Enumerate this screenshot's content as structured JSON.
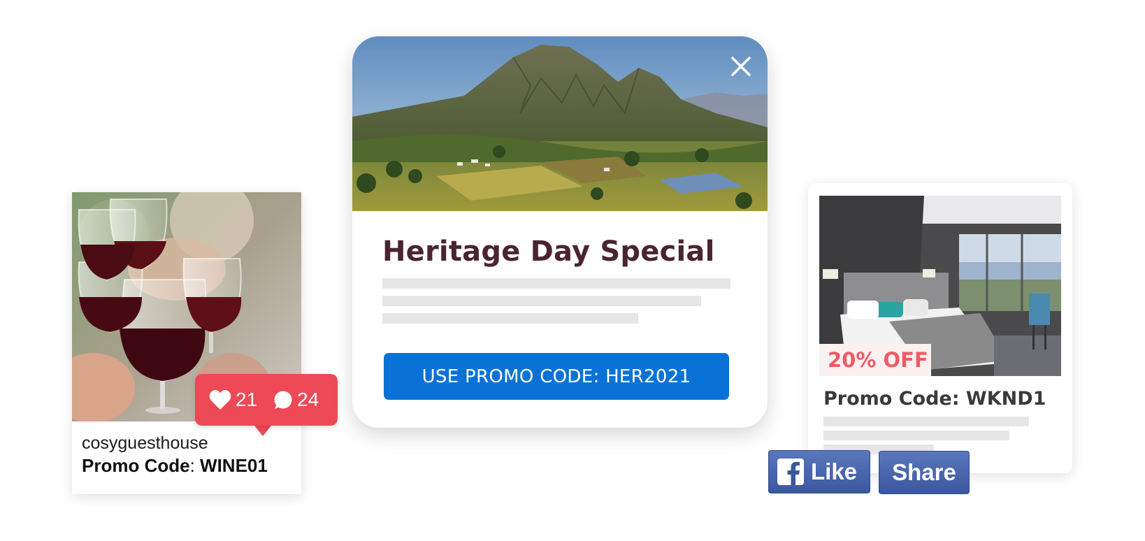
{
  "instagram_post": {
    "username": "cosyguesthouse",
    "promo_label": "Promo Code",
    "promo_separator": ":",
    "promo_code": "WINE01",
    "likes": "21",
    "comments": "24",
    "notification_color": "#ed4956",
    "photo_icon": "wine-glasses-photo"
  },
  "popup": {
    "title": "Heritage Day Special",
    "cta_label": "USE PROMO CODE: HER2021",
    "cta_color": "#0a72d6",
    "title_color": "#4a2531",
    "close_icon": "close-icon",
    "photo_icon": "mountain-vineyard-photo"
  },
  "hotel_card": {
    "discount": "20% OFF",
    "promo_text": "Promo Code: WKND1",
    "discount_color": "#ef5b66",
    "photo_icon": "hotel-room-photo"
  },
  "social": {
    "like_label": "Like",
    "share_label": "Share",
    "brand_color": "#3b579d",
    "like_icon": "facebook-logo-icon"
  }
}
